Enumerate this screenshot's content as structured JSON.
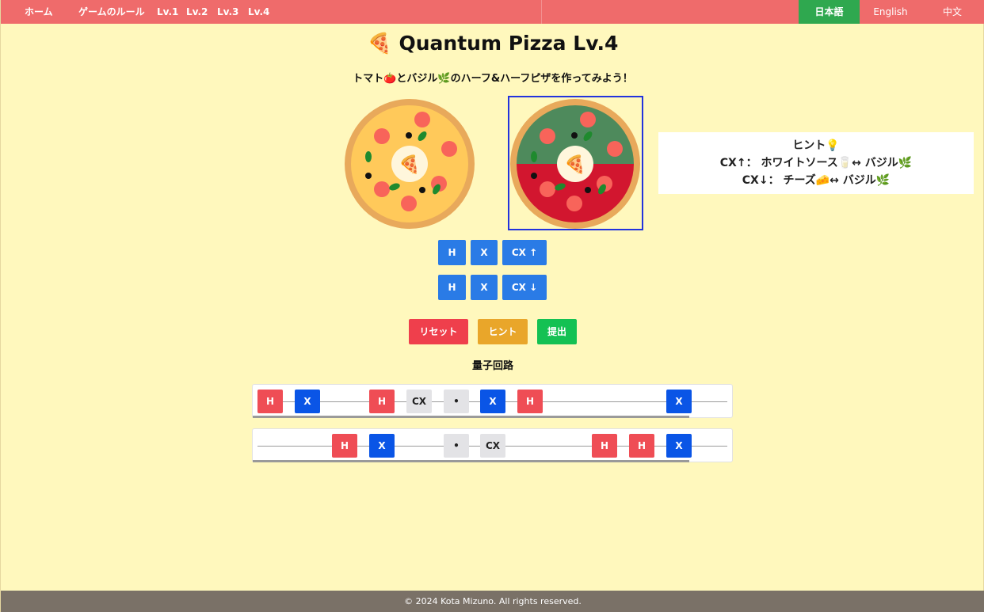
{
  "nav": {
    "items": [
      "ホーム",
      "ゲームのルール",
      "Lv.1",
      "Lv.2",
      "Lv.3",
      "Lv.4"
    ],
    "languages": [
      "日本語",
      "English",
      "中文"
    ],
    "active_language": "日本語"
  },
  "title": "🍕 Quantum Pizza Lv.4",
  "subtitle": "トマト🍅とバジル🌿のハーフ&ハーフピザを作ってみよう！",
  "hint": {
    "title": "ヒント💡",
    "line1": "CX↑： ホワイトソース🥛↔ バジル🌿",
    "line2": "CX↓： チーズ🧀↔ バジル🌿"
  },
  "gate_rows": [
    {
      "h": "H",
      "x": "X",
      "cx": "CX ↑"
    },
    {
      "h": "H",
      "x": "X",
      "cx": "CX ↓"
    }
  ],
  "actions": {
    "reset": "リセット",
    "hint": "ヒント",
    "submit": "提出"
  },
  "circuit": {
    "title": "量子回路",
    "rows": [
      [
        "H",
        "X",
        "",
        "H",
        "CX",
        "•",
        "X",
        "H",
        "",
        "",
        "",
        "X"
      ],
      [
        "",
        "",
        "H",
        "X",
        "",
        "•",
        "CX",
        "",
        "",
        "H",
        "H",
        "X"
      ]
    ]
  },
  "pizza_icon": "🍕",
  "colors": {
    "nav": "#ef6b6b",
    "background": "#fff8bd",
    "active_language": "#2fa84f",
    "gate_button": "#2a7be6",
    "reset": "#ef3f4c",
    "hint": "#e9a62a",
    "submit": "#14c153",
    "gate_H": "#ef4d55",
    "gate_X": "#0a55e6",
    "gate_CX": "#e3e3e6",
    "footer": "#7a7167",
    "pizza_target_top": "#4e8a5c",
    "pizza_target_bottom": "#d2162f",
    "cheese": "#ffc95a",
    "crust": "#e8a95b",
    "target_frame": "#2233dd"
  },
  "footer": "© 2024 Kota Mizuno. All rights reserved."
}
